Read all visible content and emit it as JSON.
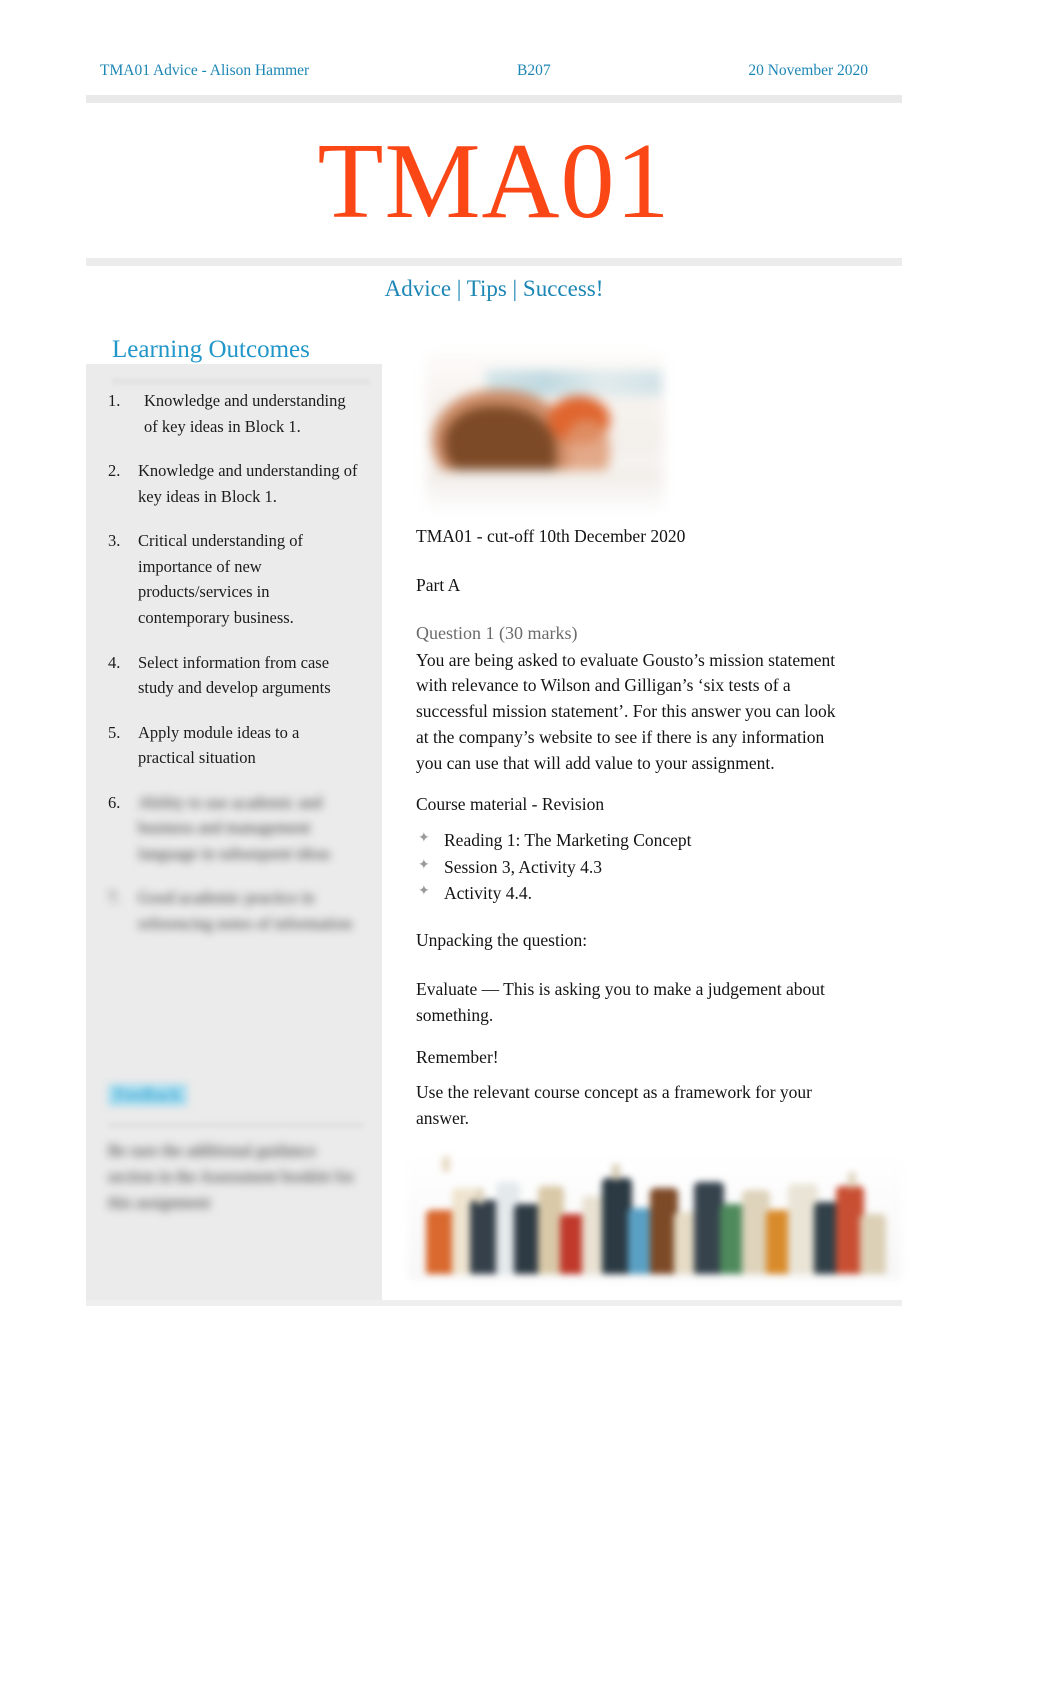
{
  "header": {
    "left": "TMA01 Advice - Alison Hammer",
    "center": "B207",
    "right": "20 November 2020",
    "accent_color": "#1C86B5"
  },
  "banner": {
    "title": "TMA01",
    "title_color": "#FB4616",
    "subtitle": "Advice | Tips | Success!",
    "subtitle_color": "#1C86B5"
  },
  "sidebar": {
    "title": "Learning Outcomes",
    "title_color": "#2196C9",
    "outcomes": [
      {
        "num": "1.",
        "text": "Knowledge and understanding of key ideas in Block 1.",
        "redacted": false
      },
      {
        "num": "2.",
        "text": "Knowledge and understanding of key ideas in Block 1.",
        "redacted": false
      },
      {
        "num": "3.",
        "text": "Critical understanding of importance of new products/services in contemporary business.",
        "redacted": false
      },
      {
        "num": "4.",
        "text": "Select information from case study and develop arguments",
        "redacted": false
      },
      {
        "num": "5.",
        "text": "Apply module ideas to a practical situation",
        "redacted": false
      },
      {
        "num": "6.",
        "text": "Ability to use academic and business and management language in subsequent ideas",
        "redacted": true
      },
      {
        "num": "7.",
        "text": "Good academic practice in referencing notes of information",
        "redacted": true
      }
    ],
    "sub_heading": "Feedback",
    "sub_heading_highlight": "#A6DCEF",
    "sub_body": "Be sure the additional guidance section in the Assessment booklet for this assignment"
  },
  "main": {
    "hero_image_alt": "coffee cup on desk photo",
    "cutoff_line": "TMA01 - cut-off 10th December 2020",
    "part_label": "Part A",
    "question_label": "Question 1 (30 marks)",
    "question_text": "You are being asked to evaluate Gousto’s mission statement with relevance to Wilson and Gilligan’s ‘six tests of a successful mission statement’. For this answer you can look at the company’s website to see if there is any information you can use that will add value to your assignment.",
    "course_material_heading": "Course material - Revision",
    "course_material_items": [
      "Reading 1: The Marketing Concept",
      "Session 3, Activity 4.3",
      "Activity 4.4."
    ],
    "bullet_glyph": "✦",
    "unpacking_heading": "Unpacking the question:",
    "evaluate_text": "Evaluate — This is asking you to make a judgement about something.",
    "remember_heading": "Remember!",
    "remember_text": "Use the relevant course concept as a framework for your answer.",
    "bottom_image_alt": "colourful bottles and jars photo"
  }
}
